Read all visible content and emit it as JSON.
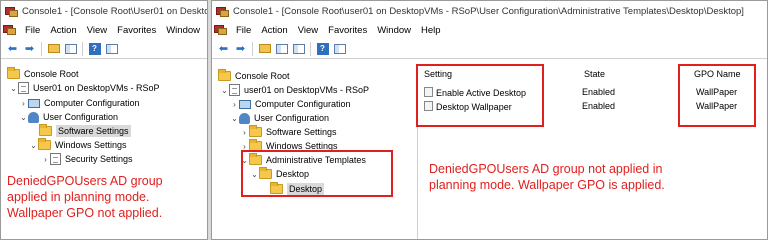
{
  "left": {
    "title": "Console1 - [Console Root\\User01 on DesktopVMs - RSoP",
    "menu": [
      "File",
      "Action",
      "View",
      "Favorites",
      "Window"
    ],
    "tree": {
      "root": "Console Root",
      "user_node": "User01 on DesktopVMs - RSoP",
      "computer_config": "Computer Configuration",
      "user_config": "User Configuration",
      "software_settings": "Software Settings",
      "windows_settings": "Windows Settings",
      "security_settings": "Security Settings"
    },
    "note": [
      "DeniedGPOUsers AD group",
      "applied in planning mode.",
      "Wallpaper GPO not applied."
    ]
  },
  "right": {
    "title": "Console1 - [Console Root\\user01 on DesktopVMs - RSoP\\User Configuration\\Administrative Templates\\Desktop\\Desktop]",
    "menu": [
      "File",
      "Action",
      "View",
      "Favorites",
      "Window",
      "Help"
    ],
    "tree": {
      "root": "Console Root",
      "user_node": "user01 on DesktopVMs - RSoP",
      "computer_config": "Computer Configuration",
      "user_config": "User Configuration",
      "software_settings": "Software Settings",
      "windows_settings": "Windows Settings",
      "admin_templates": "Administrative Templates",
      "desktop": "Desktop",
      "desktop_child": "Desktop"
    },
    "columns": {
      "setting": "Setting",
      "state": "State",
      "gpo": "GPO Name"
    },
    "rows": [
      {
        "setting": "Enable Active Desktop",
        "state": "Enabled",
        "gpo": "WallPaper"
      },
      {
        "setting": "Desktop Wallpaper",
        "state": "Enabled",
        "gpo": "WallPaper"
      }
    ],
    "note": [
      "DeniedGPOUsers AD group not applied in",
      "planning mode. Wallpaper GPO is applied."
    ]
  },
  "colors": {
    "annotation_red": "#e0201f",
    "selection": "#d9d9d9"
  },
  "icons": [
    "mmc-app-icon",
    "back-arrow-icon",
    "forward-arrow-icon",
    "up-folder-icon",
    "show-hide-tree-icon",
    "help-icon",
    "folder-icon",
    "document-icon",
    "computer-icon",
    "user-icon"
  ]
}
